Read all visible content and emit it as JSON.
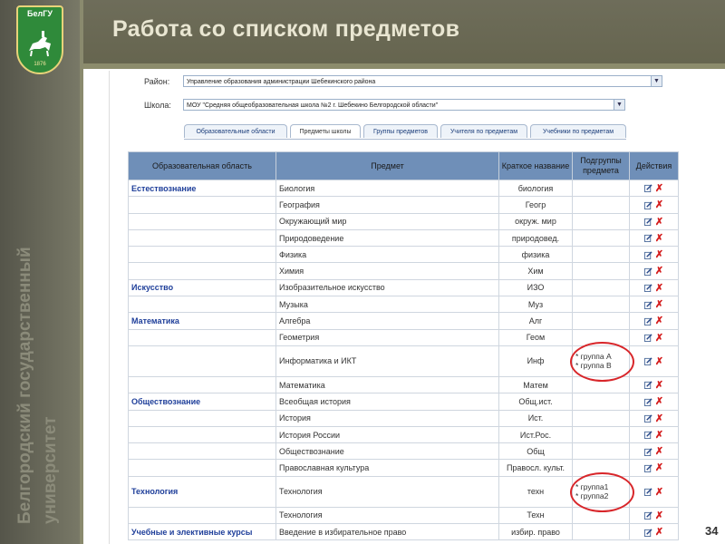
{
  "slide": {
    "title": "Работа со списком предметов",
    "logo_title": "БелГУ",
    "logo_year": "1876",
    "vertical_text_line1": "Белгородский государственный",
    "vertical_text_line2": "университет",
    "page_number": "34"
  },
  "form": {
    "district_label": "Район:",
    "district_value": "Управление образования администрации Шебекинского района",
    "school_label": "Школа:",
    "school_value": "МОУ \"Средняя общеобразовательная школа №2 г. Шебекино Белгородской области\""
  },
  "tabs": [
    {
      "label": "Образовательные области",
      "active": false
    },
    {
      "label": "Предметы школы",
      "active": true
    },
    {
      "label": "Группы предметов",
      "active": false
    },
    {
      "label": "Учителя по предметам",
      "active": false
    },
    {
      "label": "Учебники по предметам",
      "active": false
    }
  ],
  "table": {
    "headers": [
      "Образовательная область",
      "Предмет",
      "Краткое название",
      "Подгруппы предмета",
      "Действия"
    ],
    "rows": [
      {
        "area": "Естествознание",
        "subject": "Биология",
        "short": "биология",
        "subgroups": []
      },
      {
        "area": "",
        "subject": "География",
        "short": "Геогр",
        "subgroups": []
      },
      {
        "area": "",
        "subject": "Окружающий мир",
        "short": "окруж. мир",
        "subgroups": []
      },
      {
        "area": "",
        "subject": "Природоведение",
        "short": "природовед.",
        "subgroups": []
      },
      {
        "area": "",
        "subject": "Физика",
        "short": "физика",
        "subgroups": []
      },
      {
        "area": "",
        "subject": "Химия",
        "short": "Хим",
        "subgroups": []
      },
      {
        "area": "Искусство",
        "subject": "Изобразительное искусство",
        "short": "ИЗО",
        "subgroups": []
      },
      {
        "area": "",
        "subject": "Музыка",
        "short": "Муз",
        "subgroups": []
      },
      {
        "area": "Математика",
        "subject": "Алгебра",
        "short": "Алг",
        "subgroups": []
      },
      {
        "area": "",
        "subject": "Геометрия",
        "short": "Геом",
        "subgroups": []
      },
      {
        "area": "",
        "subject": "Информатика и ИКТ",
        "short": "Инф",
        "subgroups": [
          "* группа А",
          "* группа В"
        ]
      },
      {
        "area": "",
        "subject": "Математика",
        "short": "Матем",
        "subgroups": []
      },
      {
        "area": "Обществознание",
        "subject": "Всеобщая история",
        "short": "Общ.ист.",
        "subgroups": []
      },
      {
        "area": "",
        "subject": "История",
        "short": "Ист.",
        "subgroups": []
      },
      {
        "area": "",
        "subject": "История России",
        "short": "Ист.Рос.",
        "subgroups": []
      },
      {
        "area": "",
        "subject": "Обществознание",
        "short": "Общ",
        "subgroups": []
      },
      {
        "area": "",
        "subject": "Православная культура",
        "short": "Правосл. культ.",
        "subgroups": []
      },
      {
        "area": "Технология",
        "subject": "Технология",
        "short": "техн",
        "subgroups": [
          "* группа1",
          "* группа2"
        ]
      },
      {
        "area": "",
        "subject": "Технология",
        "short": "Техн",
        "subgroups": []
      },
      {
        "area": "Учебные и элективные курсы",
        "subject": "Введение в избирательное право",
        "short": "избир. право",
        "subgroups": []
      }
    ]
  },
  "icons": {
    "edit": "edit-icon",
    "delete": "delete-icon"
  },
  "colors": {
    "header_bg": "#6f8fb8",
    "area_text": "#1f3f9a",
    "delete": "#d41c1c",
    "highlight": "#d8262a"
  }
}
